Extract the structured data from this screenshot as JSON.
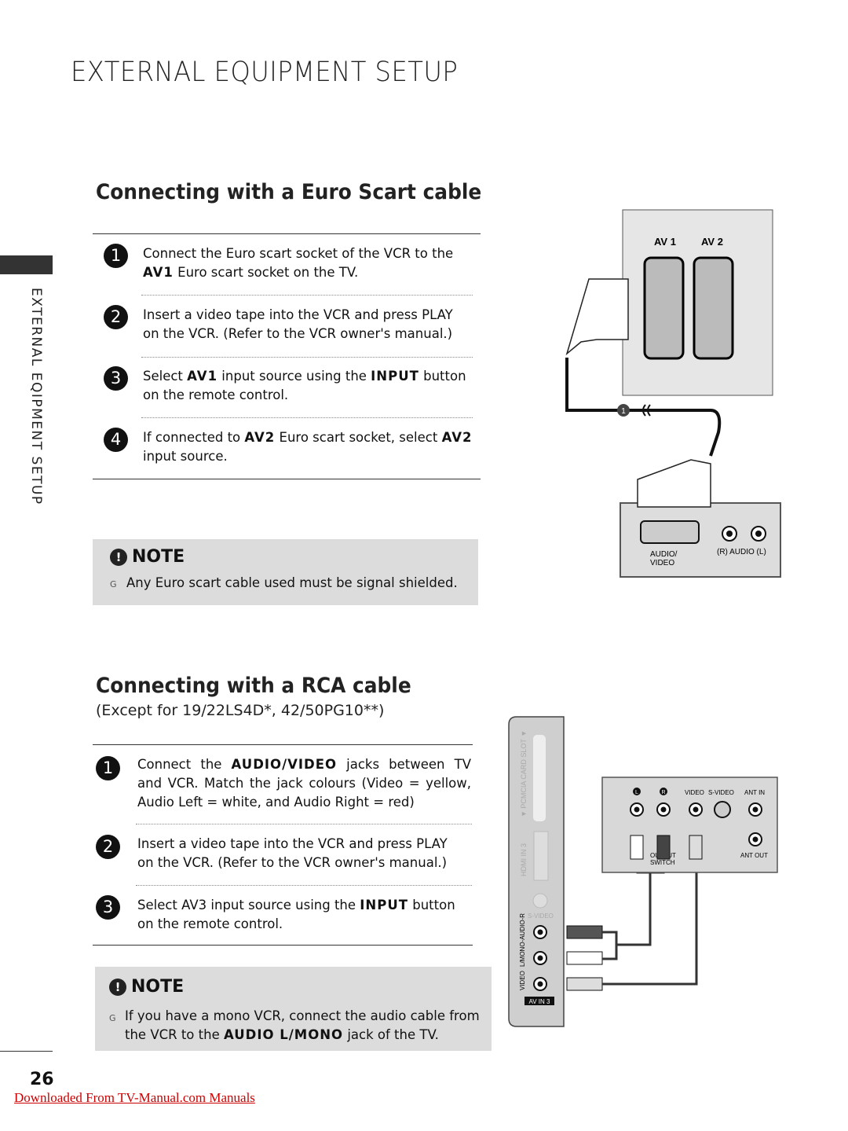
{
  "page": {
    "title": "EXTERNAL EQUIPMENT SETUP",
    "side_label": "EXTERNAL EQIPMENT SETUP",
    "page_number": "26",
    "download_link": "Downloaded From TV-Manual.com Manuals"
  },
  "scart": {
    "heading": "Connecting with a Euro Scart cable",
    "steps": [
      {
        "n": "1",
        "pre": "Connect the Euro scart socket of the VCR to the ",
        "b1": "AV1",
        "post": " Euro scart socket on the TV."
      },
      {
        "n": "2",
        "text": "Insert a video tape into the VCR and press PLAY on the VCR. (Refer to the VCR owner's manual.)"
      },
      {
        "n": "3",
        "pre": "Select ",
        "b1": "AV1",
        "mid": " input source using the ",
        "b2": "INPUT",
        "post": " button on the remote control."
      },
      {
        "n": "4",
        "pre": "If connected to ",
        "b1": "AV2",
        "mid": " Euro scart socket, select ",
        "b2": "AV2",
        "post": " input source."
      }
    ],
    "note": {
      "heading": "NOTE",
      "bullet": "G",
      "text": "Any Euro scart cable used must be signal shielded."
    },
    "diagram": {
      "av1": "AV 1",
      "av2": "AV 2",
      "callout": "1",
      "av_label_1": "AUDIO/",
      "av_label_2": "VIDEO",
      "audio_label": "(R) AUDIO (L)"
    }
  },
  "rca": {
    "heading": "Connecting with a RCA cable",
    "subheading": "(Except for 19/22LS4D*, 42/50PG10**)",
    "steps": [
      {
        "n": "1",
        "pre": "Connect the ",
        "b1": "AUDIO/VIDEO",
        "post": " jacks between TV and VCR. Match the jack colours (Video = yellow, Audio Left = white, and Audio Right = red)"
      },
      {
        "n": "2",
        "text": "Insert a video tape into the VCR and press PLAY on the VCR. (Refer to the VCR owner's manual.)"
      },
      {
        "n": "3",
        "pre": "Select AV3 input source using the ",
        "b1": "INPUT",
        "post": " button on the remote control."
      }
    ],
    "note": {
      "heading": "NOTE",
      "bullet": "G",
      "pre": "If you have a mono VCR, connect the audio cable from the VCR to the ",
      "b1": "AUDIO L/MONO",
      "post": " jack of the TV."
    },
    "diagram": {
      "pcmcia": "▼ PCMCIA CARD SLOT ▼",
      "hdmi": "HDMI IN 3",
      "svideo_tv": "S-VIDEO",
      "video_tv": "VIDEO",
      "audio_tv": "L/MONO-AUDIO-R",
      "av_in": "AV IN 3",
      "l": "L",
      "r": "R",
      "video": "VIDEO",
      "svideo": "S-VIDEO",
      "ant_in": "ANT IN",
      "ant_out": "ANT OUT",
      "output_switch_1": "OUTPUT",
      "output_switch_2": "SWITCH"
    }
  }
}
